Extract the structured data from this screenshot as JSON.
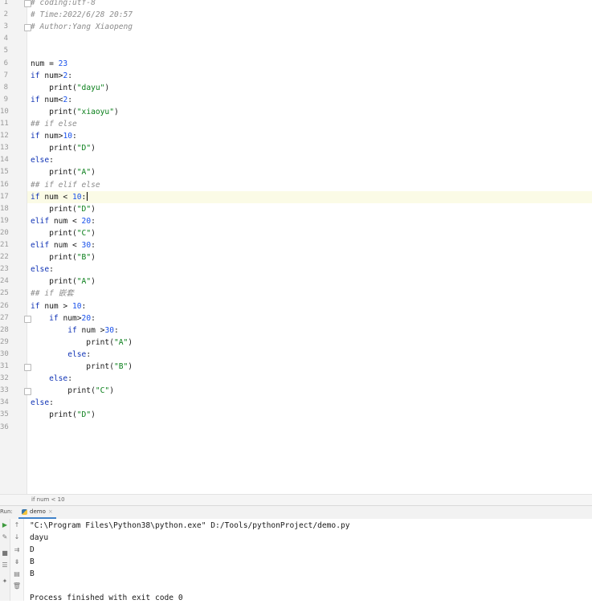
{
  "editor": {
    "line_numbers": [
      "1",
      "2",
      "3",
      "4",
      "5",
      "6",
      "7",
      "8",
      "9",
      "10",
      "11",
      "12",
      "13",
      "14",
      "15",
      "16",
      "17",
      "18",
      "19",
      "20",
      "21",
      "22",
      "23",
      "24",
      "25",
      "26",
      "27",
      "28",
      "29",
      "30",
      "31",
      "32",
      "33",
      "34",
      "35",
      "36"
    ],
    "lines": [
      [
        {
          "t": "# coding:utf-8",
          "c": "cm"
        }
      ],
      [
        {
          "t": "# Time:2022/6/28 20:57",
          "c": "cm"
        }
      ],
      [
        {
          "t": "# Author:Yang Xiaopeng",
          "c": "cm"
        }
      ],
      [],
      [],
      [
        {
          "t": "num = "
        },
        {
          "t": "23",
          "c": "num"
        }
      ],
      [
        {
          "t": "if ",
          "c": "kw"
        },
        {
          "t": "num>"
        },
        {
          "t": "2",
          "c": "num"
        },
        {
          "t": ":"
        }
      ],
      [
        {
          "t": "    print("
        },
        {
          "t": "\"dayu\"",
          "c": "str"
        },
        {
          "t": ")"
        }
      ],
      [
        {
          "t": "if ",
          "c": "kw"
        },
        {
          "t": "num<"
        },
        {
          "t": "2",
          "c": "num"
        },
        {
          "t": ":"
        }
      ],
      [
        {
          "t": "    print("
        },
        {
          "t": "\"xiaoyu\"",
          "c": "str"
        },
        {
          "t": ")"
        }
      ],
      [
        {
          "t": "## if else",
          "c": "cm"
        }
      ],
      [
        {
          "t": "if ",
          "c": "kw"
        },
        {
          "t": "num>"
        },
        {
          "t": "10",
          "c": "num"
        },
        {
          "t": ":"
        }
      ],
      [
        {
          "t": "    print("
        },
        {
          "t": "\"D\"",
          "c": "str"
        },
        {
          "t": ")"
        }
      ],
      [
        {
          "t": "else",
          "c": "kw"
        },
        {
          "t": ":"
        }
      ],
      [
        {
          "t": "    print("
        },
        {
          "t": "\"A\"",
          "c": "str"
        },
        {
          "t": ")"
        }
      ],
      [
        {
          "t": "## if elif else",
          "c": "cm"
        }
      ],
      [
        {
          "t": "if ",
          "c": "kw"
        },
        {
          "t": "num < "
        },
        {
          "t": "10",
          "c": "num"
        },
        {
          "t": ":"
        }
      ],
      [
        {
          "t": "    print("
        },
        {
          "t": "\"D\"",
          "c": "str"
        },
        {
          "t": ")"
        }
      ],
      [
        {
          "t": "elif ",
          "c": "kw"
        },
        {
          "t": "num < "
        },
        {
          "t": "20",
          "c": "num"
        },
        {
          "t": ":"
        }
      ],
      [
        {
          "t": "    print("
        },
        {
          "t": "\"C\"",
          "c": "str"
        },
        {
          "t": ")"
        }
      ],
      [
        {
          "t": "elif ",
          "c": "kw"
        },
        {
          "t": "num < "
        },
        {
          "t": "30",
          "c": "num"
        },
        {
          "t": ":"
        }
      ],
      [
        {
          "t": "    print("
        },
        {
          "t": "\"B\"",
          "c": "str"
        },
        {
          "t": ")"
        }
      ],
      [
        {
          "t": "else",
          "c": "kw"
        },
        {
          "t": ":"
        }
      ],
      [
        {
          "t": "    print("
        },
        {
          "t": "\"A\"",
          "c": "str"
        },
        {
          "t": ")"
        }
      ],
      [
        {
          "t": "## if 嵌套",
          "c": "cm"
        }
      ],
      [
        {
          "t": "if ",
          "c": "kw"
        },
        {
          "t": "num > "
        },
        {
          "t": "10",
          "c": "num"
        },
        {
          "t": ":"
        }
      ],
      [
        {
          "t": "    if ",
          "c": "kw"
        },
        {
          "t": "num>"
        },
        {
          "t": "20",
          "c": "num"
        },
        {
          "t": ":"
        }
      ],
      [
        {
          "t": "        if ",
          "c": "kw"
        },
        {
          "t": "num >"
        },
        {
          "t": "30",
          "c": "num"
        },
        {
          "t": ":"
        }
      ],
      [
        {
          "t": "            print("
        },
        {
          "t": "\"A\"",
          "c": "str"
        },
        {
          "t": ")"
        }
      ],
      [
        {
          "t": "        else",
          "c": "kw"
        },
        {
          "t": ":"
        }
      ],
      [
        {
          "t": "            print("
        },
        {
          "t": "\"B\"",
          "c": "str"
        },
        {
          "t": ")"
        }
      ],
      [
        {
          "t": "    else",
          "c": "kw"
        },
        {
          "t": ":"
        }
      ],
      [
        {
          "t": "        print("
        },
        {
          "t": "\"C\"",
          "c": "str"
        },
        {
          "t": ")"
        }
      ],
      [
        {
          "t": "else",
          "c": "kw"
        },
        {
          "t": ":"
        }
      ],
      [
        {
          "t": "    print("
        },
        {
          "t": "\"D\"",
          "c": "str"
        },
        {
          "t": ")"
        }
      ],
      []
    ],
    "current_line": 17
  },
  "breadcrumb": "if num < 10",
  "run_panel": {
    "label": "Run:",
    "tab_name": "demo",
    "tab_close": "×",
    "output": [
      "\"C:\\Program Files\\Python38\\python.exe\" D:/Tools/pythonProject/demo.py",
      "dayu",
      "D",
      "B",
      "B",
      "",
      "Process finished with exit code 0"
    ]
  },
  "icons": [
    "play-icon",
    "up-arrow-icon",
    "wrench-icon",
    "down-arrow-icon",
    "stop-icon",
    "soft-wrap-icon",
    "layout-icon",
    "scroll-end-icon",
    "pin-icon",
    "print-icon",
    "trash-icon"
  ]
}
